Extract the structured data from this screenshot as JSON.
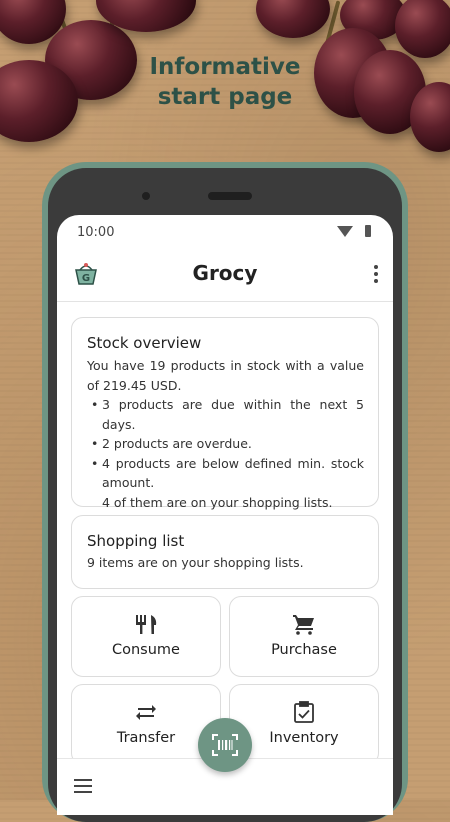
{
  "headline": "Informative\nstart page",
  "status_bar": {
    "time": "10:00"
  },
  "app_bar": {
    "title": "Grocy",
    "logo_letter": "G"
  },
  "stock_overview": {
    "title": "Stock overview",
    "summary": "You have 19 products in stock with a value of 219.45 USD.",
    "bullets": [
      "3 products are due within the next 5 days.",
      "2 products are overdue.",
      "4 products are below defined min. stock amount."
    ],
    "note": "4 of them are on your shopping lists."
  },
  "shopping_list": {
    "title": "Shopping list",
    "summary": "9 items are on your shopping lists."
  },
  "actions": [
    {
      "label": "Consume",
      "icon": "fork-knife-icon"
    },
    {
      "label": "Purchase",
      "icon": "cart-icon"
    },
    {
      "label": "Transfer",
      "icon": "transfer-arrows-icon"
    },
    {
      "label": "Inventory",
      "icon": "clipboard-check-icon"
    }
  ],
  "colors": {
    "accent": "#6e9584",
    "headline": "#2d5147"
  }
}
